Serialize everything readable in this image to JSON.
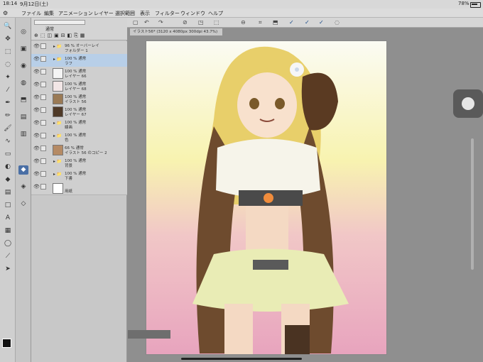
{
  "status": {
    "time": "18:14",
    "date": "9月12日(土)",
    "battery": "78%"
  },
  "menu": [
    "ファイル",
    "編集",
    "アニメーション",
    "レイヤー",
    "選択範囲",
    "表示",
    "フィルター",
    "ウィンドウ",
    "ヘルプ"
  ],
  "panel": {
    "blend_mode": "通常"
  },
  "layers": [
    {
      "opacity": "96 % オーバーレイ",
      "name": "フォルダー 1",
      "kind": "folder"
    },
    {
      "opacity": "100 % 通常",
      "name": "ラフ",
      "kind": "folder",
      "selected": true
    },
    {
      "opacity": "100 % 通常",
      "name": "レイヤー 66",
      "kind": "raster",
      "thumb": "#f4f4f4"
    },
    {
      "opacity": "100 % 通常",
      "name": "レイヤー 68",
      "kind": "raster",
      "thumb": "#f2e6e6"
    },
    {
      "opacity": "100 % 通常",
      "name": "イラスト 56",
      "kind": "raster",
      "thumb": "#9a7a55"
    },
    {
      "opacity": "100 % 通常",
      "name": "レイヤー 67",
      "kind": "raster",
      "thumb": "#4f3a28"
    },
    {
      "opacity": "100 % 通常",
      "name": "線画",
      "kind": "folder"
    },
    {
      "opacity": "100 % 通常",
      "name": "色",
      "kind": "folder"
    },
    {
      "opacity": "66 % 通常",
      "name": "イラスト 56 のコピー 2",
      "kind": "raster",
      "thumb": "#b58a64"
    },
    {
      "opacity": "100 % 通常",
      "name": "背景",
      "kind": "folder"
    },
    {
      "opacity": "100 % 通常",
      "name": "下書",
      "kind": "folder"
    },
    {
      "opacity": "",
      "name": "用紙",
      "kind": "paper",
      "thumb": "#ffffff"
    }
  ],
  "document": {
    "tab_label": "イラスト56* (3120 x 4080px 300dpi 43.7%)"
  },
  "colors": {
    "accent": "#4a6fa5",
    "selected_layer": "#b8cfe8"
  }
}
